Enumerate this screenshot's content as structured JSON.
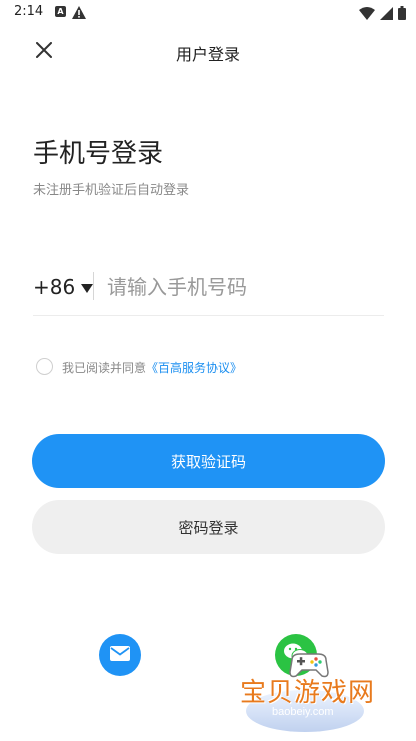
{
  "status_bar": {
    "time": "2:14",
    "a_icon_label": "A"
  },
  "header": {
    "title": "用户登录"
  },
  "login": {
    "title": "手机号登录",
    "subtitle": "未注册手机验证后自动登录"
  },
  "phone": {
    "country_code": "+86",
    "placeholder": "请输入手机号码",
    "value": ""
  },
  "agreement": {
    "text": "我已阅读并同意",
    "link": "《百高服务协议》",
    "checked": false
  },
  "buttons": {
    "get_code": "获取验证码",
    "password_login": "密码登录"
  },
  "social": {
    "icons": [
      "mail-icon",
      "wechat-icon"
    ]
  },
  "watermark": {
    "text": "宝贝游戏网",
    "url": "baobeiy.com"
  },
  "colors": {
    "primary": "#1f93f5",
    "secondary_bg": "#efefef",
    "link": "#1a8ef0",
    "wechat": "#2bc343",
    "watermark_text": "#e87a1d"
  }
}
